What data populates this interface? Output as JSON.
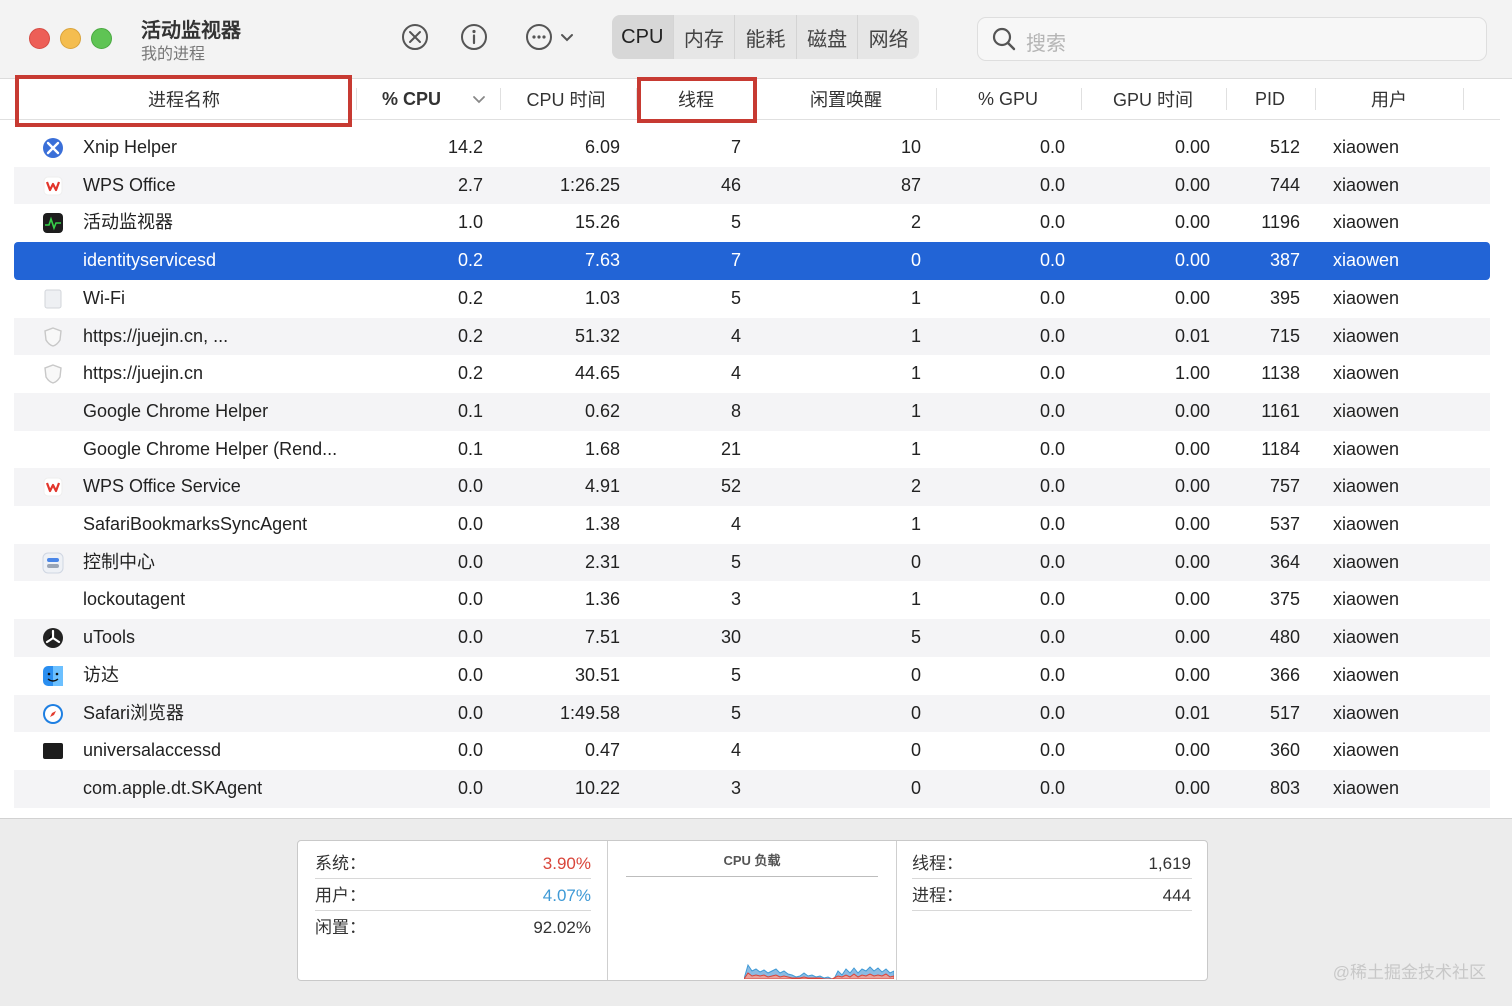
{
  "window": {
    "title": "活动监视器",
    "subtitle": "我的进程"
  },
  "toolbar": {
    "icons": [
      "close-circle-icon",
      "info-icon",
      "more-icon",
      "chevron-down-icon"
    ],
    "tabs": [
      {
        "label": "CPU",
        "active": true
      },
      {
        "label": "内存",
        "active": false
      },
      {
        "label": "能耗",
        "active": false
      },
      {
        "label": "磁盘",
        "active": false
      },
      {
        "label": "网络",
        "active": false
      }
    ],
    "search_placeholder": "搜索"
  },
  "table": {
    "columns": [
      "进程名称",
      "% CPU",
      "CPU 时间",
      "线程",
      "闲置唤醒",
      "% GPU",
      "GPU 时间",
      "PID",
      "用户"
    ],
    "highlighted_columns": [
      "进程名称",
      "线程"
    ],
    "rows": [
      {
        "icon": "xnip-icon",
        "name": "Xnip Helper",
        "cpu": "14.2",
        "time": "6.09",
        "threads": "7",
        "idle": "10",
        "gpu": "0.0",
        "gputime": "0.00",
        "pid": "512",
        "user": "xiaowen"
      },
      {
        "icon": "wps-icon",
        "name": "WPS Office",
        "cpu": "2.7",
        "time": "1:26.25",
        "threads": "46",
        "idle": "87",
        "gpu": "0.0",
        "gputime": "0.00",
        "pid": "744",
        "user": "xiaowen"
      },
      {
        "icon": "activity-monitor-icon",
        "name": "活动监视器",
        "cpu": "1.0",
        "time": "15.26",
        "threads": "5",
        "idle": "2",
        "gpu": "0.0",
        "gputime": "0.00",
        "pid": "1196",
        "user": "xiaowen"
      },
      {
        "icon": "",
        "name": "identityservicesd",
        "cpu": "0.2",
        "time": "7.63",
        "threads": "7",
        "idle": "0",
        "gpu": "0.0",
        "gputime": "0.00",
        "pid": "387",
        "user": "xiaowen",
        "selected": true
      },
      {
        "icon": "wifi-icon",
        "name": "Wi-Fi",
        "cpu": "0.2",
        "time": "1.03",
        "threads": "5",
        "idle": "1",
        "gpu": "0.0",
        "gputime": "0.00",
        "pid": "395",
        "user": "xiaowen"
      },
      {
        "icon": "shield-icon",
        "name": "https://juejin.cn, ...",
        "cpu": "0.2",
        "time": "51.32",
        "threads": "4",
        "idle": "1",
        "gpu": "0.0",
        "gputime": "0.01",
        "pid": "715",
        "user": "xiaowen"
      },
      {
        "icon": "shield-icon",
        "name": "https://juejin.cn",
        "cpu": "0.2",
        "time": "44.65",
        "threads": "4",
        "idle": "1",
        "gpu": "0.0",
        "gputime": "1.00",
        "pid": "1138",
        "user": "xiaowen"
      },
      {
        "icon": "",
        "name": "Google Chrome Helper",
        "cpu": "0.1",
        "time": "0.62",
        "threads": "8",
        "idle": "1",
        "gpu": "0.0",
        "gputime": "0.00",
        "pid": "1161",
        "user": "xiaowen"
      },
      {
        "icon": "",
        "name": "Google Chrome Helper (Rend...",
        "cpu": "0.1",
        "time": "1.68",
        "threads": "21",
        "idle": "1",
        "gpu": "0.0",
        "gputime": "0.00",
        "pid": "1184",
        "user": "xiaowen"
      },
      {
        "icon": "wps-icon",
        "name": "WPS Office Service",
        "cpu": "0.0",
        "time": "4.91",
        "threads": "52",
        "idle": "2",
        "gpu": "0.0",
        "gputime": "0.00",
        "pid": "757",
        "user": "xiaowen"
      },
      {
        "icon": "",
        "name": "SafariBookmarksSyncAgent",
        "cpu": "0.0",
        "time": "1.38",
        "threads": "4",
        "idle": "1",
        "gpu": "0.0",
        "gputime": "0.00",
        "pid": "537",
        "user": "xiaowen"
      },
      {
        "icon": "control-center-icon",
        "name": "控制中心",
        "cpu": "0.0",
        "time": "2.31",
        "threads": "5",
        "idle": "0",
        "gpu": "0.0",
        "gputime": "0.00",
        "pid": "364",
        "user": "xiaowen"
      },
      {
        "icon": "",
        "name": "lockoutagent",
        "cpu": "0.0",
        "time": "1.36",
        "threads": "3",
        "idle": "1",
        "gpu": "0.0",
        "gputime": "0.00",
        "pid": "375",
        "user": "xiaowen"
      },
      {
        "icon": "utools-icon",
        "name": "uTools",
        "cpu": "0.0",
        "time": "7.51",
        "threads": "30",
        "idle": "5",
        "gpu": "0.0",
        "gputime": "0.00",
        "pid": "480",
        "user": "xiaowen"
      },
      {
        "icon": "finder-icon",
        "name": "访达",
        "cpu": "0.0",
        "time": "30.51",
        "threads": "5",
        "idle": "0",
        "gpu": "0.0",
        "gputime": "0.00",
        "pid": "366",
        "user": "xiaowen"
      },
      {
        "icon": "safari-icon",
        "name": "Safari浏览器",
        "cpu": "0.0",
        "time": "1:49.58",
        "threads": "5",
        "idle": "0",
        "gpu": "0.0",
        "gputime": "0.01",
        "pid": "517",
        "user": "xiaowen"
      },
      {
        "icon": "terminal-icon",
        "name": "universalaccessd",
        "cpu": "0.0",
        "time": "0.47",
        "threads": "4",
        "idle": "0",
        "gpu": "0.0",
        "gputime": "0.00",
        "pid": "360",
        "user": "xiaowen"
      },
      {
        "icon": "",
        "name": "com.apple.dt.SKAgent",
        "cpu": "0.0",
        "time": "10.22",
        "threads": "3",
        "idle": "0",
        "gpu": "0.0",
        "gputime": "0.00",
        "pid": "803",
        "user": "xiaowen"
      }
    ]
  },
  "summary": {
    "system_label": "系统：",
    "system_value": "3.90%",
    "system_color": "#d9453a",
    "user_label": "用户：",
    "user_value": "4.07%",
    "user_color": "#3f9ad6",
    "idle_label": "闲置：",
    "idle_value": "92.02%",
    "cpu_load_title": "CPU 负载",
    "threads_label": "线程：",
    "threads_value": "1,619",
    "processes_label": "进程：",
    "processes_value": "444"
  },
  "watermark": "@稀土掘金技术社区"
}
